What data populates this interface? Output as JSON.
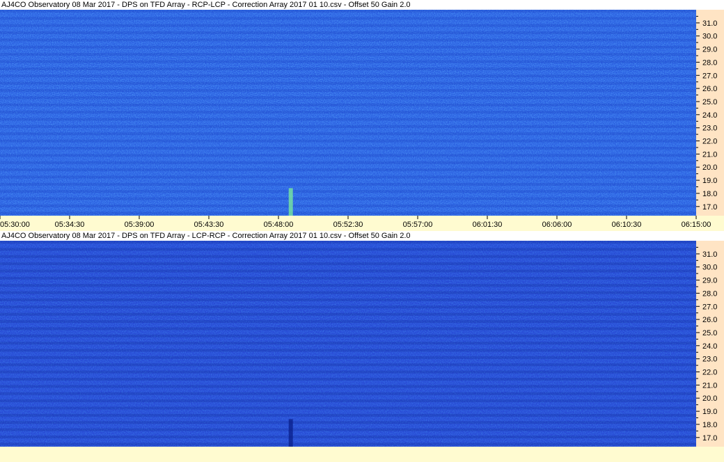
{
  "chart_data": [
    {
      "type": "heatmap",
      "title": "AJ4CO Observatory 08 Mar 2017  -  DPS on TFD Array  -  RCP-LCP  -  Correction Array 2017 01 10.csv  -  Offset 50  Gain 2.0",
      "xlabel": "",
      "ylabel": "",
      "x_ticks": [
        "05:30:00",
        "05:34:30",
        "05:39:00",
        "05:43:30",
        "05:48:00",
        "05:52:30",
        "05:57:00",
        "06:01:30",
        "06:06:00",
        "06:10:30",
        "06:15:00"
      ],
      "y_ticks": [
        31.0,
        30.0,
        29.0,
        28.0,
        27.0,
        26.0,
        25.0,
        24.0,
        23.0,
        22.0,
        21.0,
        20.0,
        19.0,
        18.0,
        17.0
      ],
      "xlim": [
        "05:30:00",
        "06:15:00"
      ],
      "ylim": [
        16.3,
        32.0
      ],
      "colors": {
        "base": "#2a5ee0",
        "low": "#1034b8",
        "high": "#40b0ff",
        "peak": "#7ef09a"
      }
    },
    {
      "type": "heatmap",
      "title": "AJ4CO Observatory 08 Mar 2017  -  DPS on TFD Array  -  LCP-RCP  -  Correction Array 2017 01 10.csv  -  Offset 50  Gain 2.0",
      "xlabel": "",
      "ylabel": "",
      "x_ticks": [],
      "y_ticks": [
        31.0,
        30.0,
        29.0,
        28.0,
        27.0,
        26.0,
        25.0,
        24.0,
        23.0,
        22.0,
        21.0,
        20.0,
        19.0,
        18.0,
        17.0
      ],
      "xlim": [
        "05:30:00",
        "06:15:00"
      ],
      "ylim": [
        16.3,
        32.0
      ],
      "colors": {
        "base": "#2748d4",
        "low": "#0a1f8a",
        "high": "#3f8ef4",
        "peak": "#63c8ff"
      }
    }
  ]
}
